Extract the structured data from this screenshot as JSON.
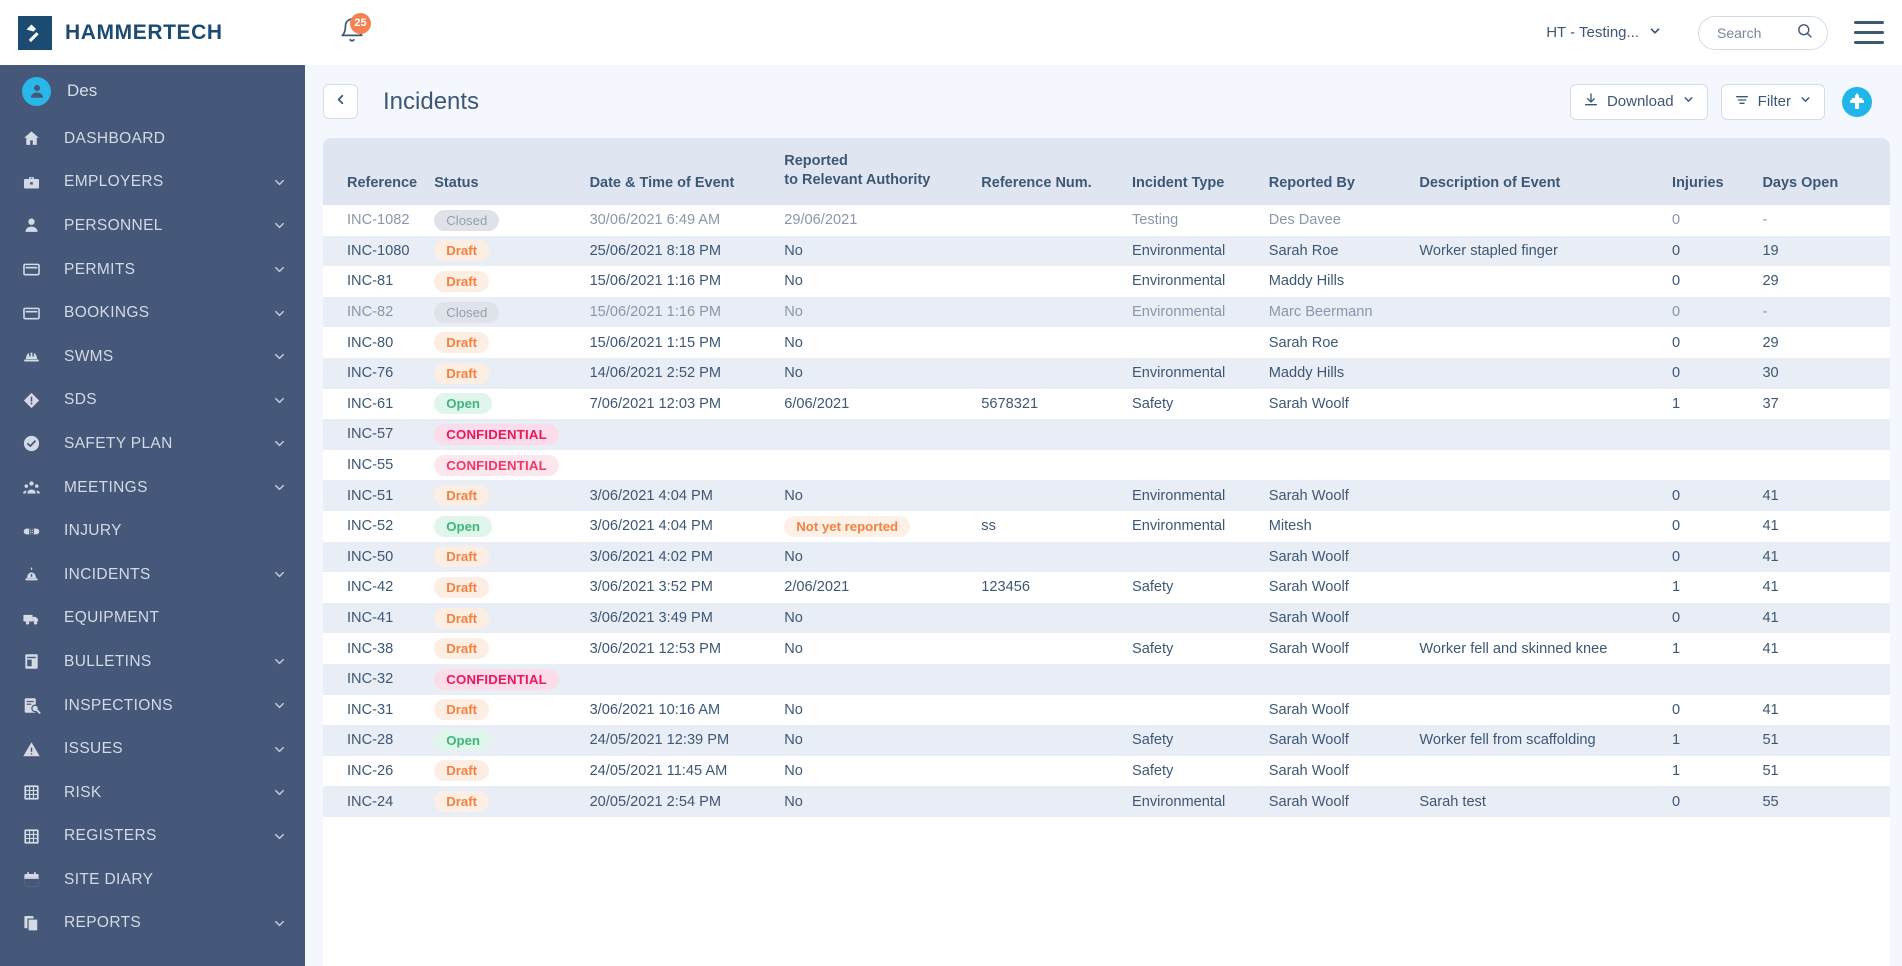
{
  "topbar": {
    "brand": "HAMMERTECH",
    "brand_icon": "hammer-logo-icon",
    "notification_icon": "bell-icon",
    "notification_count": "25",
    "site_selector_label": "HT - Testing...",
    "site_selector_caret": "chevron-down-icon",
    "search_placeholder": "Search",
    "search_value": "",
    "search_icon": "search-icon",
    "menu_icon": "hamburger-menu-icon"
  },
  "sidebar": {
    "user": {
      "name": "Des",
      "avatar_icon": "user-avatar-icon"
    },
    "items": [
      {
        "label": "DASHBOARD",
        "icon": "home-icon",
        "expandable": false
      },
      {
        "label": "EMPLOYERS",
        "icon": "briefcase-icon",
        "expandable": true
      },
      {
        "label": "PERSONNEL",
        "icon": "person-icon",
        "expandable": true
      },
      {
        "label": "PERMITS",
        "icon": "card-icon",
        "expandable": true
      },
      {
        "label": "BOOKINGS",
        "icon": "card-icon",
        "expandable": true
      },
      {
        "label": "SWMS",
        "icon": "hardhat-icon",
        "expandable": true
      },
      {
        "label": "SDS",
        "icon": "diamond-alert-icon",
        "expandable": true
      },
      {
        "label": "SAFETY PLAN",
        "icon": "check-circle-icon",
        "expandable": true
      },
      {
        "label": "MEETINGS",
        "icon": "people-group-icon",
        "expandable": true
      },
      {
        "label": "INJURY",
        "icon": "bandage-icon",
        "expandable": false
      },
      {
        "label": "INCIDENTS",
        "icon": "siren-icon",
        "expandable": true
      },
      {
        "label": "EQUIPMENT",
        "icon": "truck-icon",
        "expandable": false
      },
      {
        "label": "BULLETINS",
        "icon": "bulletin-icon",
        "expandable": true
      },
      {
        "label": "INSPECTIONS",
        "icon": "inspection-icon",
        "expandable": true
      },
      {
        "label": "ISSUES",
        "icon": "warning-triangle-icon",
        "expandable": true
      },
      {
        "label": "RISK",
        "icon": "grid-matrix-icon",
        "expandable": true
      },
      {
        "label": "REGISTERS",
        "icon": "grid-matrix-icon",
        "expandable": true
      },
      {
        "label": "SITE DIARY",
        "icon": "calendar-icon",
        "expandable": false
      },
      {
        "label": "REPORTS",
        "icon": "documents-icon",
        "expandable": true
      }
    ]
  },
  "page": {
    "back_icon": "chevron-left-icon",
    "title": "Incidents",
    "download_label": "Download",
    "download_icon": "download-icon",
    "download_caret": "chevron-down-icon",
    "filter_label": "Filter",
    "filter_icon": "filter-icon",
    "filter_caret": "chevron-down-icon",
    "add_icon": "plus-icon"
  },
  "table": {
    "columns": [
      {
        "key": "reference",
        "label": "Reference"
      },
      {
        "key": "status",
        "label": "Status"
      },
      {
        "key": "datetime",
        "label": "Date & Time of Event"
      },
      {
        "key": "reported",
        "label_line1": "Reported",
        "label_line2": "to Relevant Authority"
      },
      {
        "key": "refnum",
        "label": "Reference Num."
      },
      {
        "key": "type",
        "label": "Incident Type"
      },
      {
        "key": "reportedby",
        "label": "Reported By"
      },
      {
        "key": "description",
        "label": "Description of Event"
      },
      {
        "key": "injuries",
        "label": "Injuries"
      },
      {
        "key": "daysopen",
        "label": "Days Open"
      }
    ],
    "rows": [
      {
        "reference": "INC-1082",
        "status": "Closed",
        "status_kind": "closed",
        "muted": true,
        "datetime": "30/06/2021 6:49 AM",
        "reported": "29/06/2021",
        "reported_kind": "text",
        "refnum": "",
        "type": "Testing",
        "reportedby": "Des Davee",
        "description": "",
        "injuries": "0",
        "daysopen": "-"
      },
      {
        "reference": "INC-1080",
        "status": "Draft",
        "status_kind": "draft",
        "muted": false,
        "datetime": "25/06/2021 8:18 PM",
        "reported": "No",
        "reported_kind": "text",
        "refnum": "",
        "type": "Environmental",
        "reportedby": "Sarah Roe",
        "description": "Worker stapled finger",
        "injuries": "0",
        "daysopen": "19"
      },
      {
        "reference": "INC-81",
        "status": "Draft",
        "status_kind": "draft",
        "muted": false,
        "datetime": "15/06/2021 1:16 PM",
        "reported": "No",
        "reported_kind": "text",
        "refnum": "",
        "type": "Environmental",
        "reportedby": "Maddy Hills",
        "description": "",
        "injuries": "0",
        "daysopen": "29"
      },
      {
        "reference": "INC-82",
        "status": "Closed",
        "status_kind": "closed",
        "muted": true,
        "datetime": "15/06/2021 1:16 PM",
        "reported": "No",
        "reported_kind": "text",
        "refnum": "",
        "type": "Environmental",
        "reportedby": "Marc Beermann",
        "description": "",
        "injuries": "0",
        "daysopen": "-"
      },
      {
        "reference": "INC-80",
        "status": "Draft",
        "status_kind": "draft",
        "muted": false,
        "datetime": "15/06/2021 1:15 PM",
        "reported": "No",
        "reported_kind": "text",
        "refnum": "",
        "type": "",
        "reportedby": "Sarah Roe",
        "description": "",
        "injuries": "0",
        "daysopen": "29"
      },
      {
        "reference": "INC-76",
        "status": "Draft",
        "status_kind": "draft",
        "muted": false,
        "datetime": "14/06/2021 2:52 PM",
        "reported": "No",
        "reported_kind": "text",
        "refnum": "",
        "type": "Environmental",
        "reportedby": "Maddy Hills",
        "description": "",
        "injuries": "0",
        "daysopen": "30"
      },
      {
        "reference": "INC-61",
        "status": "Open",
        "status_kind": "open",
        "muted": false,
        "datetime": "7/06/2021 12:03 PM",
        "reported": "6/06/2021",
        "reported_kind": "text",
        "refnum": "5678321",
        "type": "Safety",
        "reportedby": "Sarah Woolf",
        "description": "",
        "injuries": "1",
        "daysopen": "37"
      },
      {
        "reference": "INC-57",
        "status": "CONFIDENTIAL",
        "status_kind": "confidential",
        "muted": false,
        "datetime": "",
        "reported": "",
        "reported_kind": "text",
        "refnum": "",
        "type": "",
        "reportedby": "",
        "description": "",
        "injuries": "",
        "daysopen": ""
      },
      {
        "reference": "INC-55",
        "status": "CONFIDENTIAL",
        "status_kind": "confidential-light",
        "muted": false,
        "datetime": "",
        "reported": "",
        "reported_kind": "text",
        "refnum": "",
        "type": "",
        "reportedby": "",
        "description": "",
        "injuries": "",
        "daysopen": ""
      },
      {
        "reference": "INC-51",
        "status": "Draft",
        "status_kind": "draft",
        "muted": false,
        "datetime": "3/06/2021 4:04 PM",
        "reported": "No",
        "reported_kind": "text",
        "refnum": "",
        "type": "Environmental",
        "reportedby": "Sarah Woolf",
        "description": "",
        "injuries": "0",
        "daysopen": "41"
      },
      {
        "reference": "INC-52",
        "status": "Open",
        "status_kind": "open",
        "muted": false,
        "datetime": "3/06/2021 4:04 PM",
        "reported": "Not yet reported",
        "reported_kind": "pill",
        "refnum": "ss",
        "type": "Environmental",
        "reportedby": "Mitesh",
        "description": "",
        "injuries": "0",
        "daysopen": "41"
      },
      {
        "reference": "INC-50",
        "status": "Draft",
        "status_kind": "draft",
        "muted": false,
        "datetime": "3/06/2021 4:02 PM",
        "reported": "No",
        "reported_kind": "text",
        "refnum": "",
        "type": "",
        "reportedby": "Sarah Woolf",
        "description": "",
        "injuries": "0",
        "daysopen": "41"
      },
      {
        "reference": "INC-42",
        "status": "Draft",
        "status_kind": "draft",
        "muted": false,
        "datetime": "3/06/2021 3:52 PM",
        "reported": "2/06/2021",
        "reported_kind": "text",
        "refnum": "123456",
        "type": "Safety",
        "reportedby": "Sarah Woolf",
        "description": "",
        "injuries": "1",
        "daysopen": "41"
      },
      {
        "reference": "INC-41",
        "status": "Draft",
        "status_kind": "draft",
        "muted": false,
        "datetime": "3/06/2021 3:49 PM",
        "reported": "No",
        "reported_kind": "text",
        "refnum": "",
        "type": "",
        "reportedby": "Sarah Woolf",
        "description": "",
        "injuries": "0",
        "daysopen": "41"
      },
      {
        "reference": "INC-38",
        "status": "Draft",
        "status_kind": "draft",
        "muted": false,
        "datetime": "3/06/2021 12:53 PM",
        "reported": "No",
        "reported_kind": "text",
        "refnum": "",
        "type": "Safety",
        "reportedby": "Sarah Woolf",
        "description": "Worker fell and skinned knee",
        "injuries": "1",
        "daysopen": "41"
      },
      {
        "reference": "INC-32",
        "status": "CONFIDENTIAL",
        "status_kind": "confidential",
        "muted": false,
        "datetime": "",
        "reported": "",
        "reported_kind": "text",
        "refnum": "",
        "type": "",
        "reportedby": "",
        "description": "",
        "injuries": "",
        "daysopen": ""
      },
      {
        "reference": "INC-31",
        "status": "Draft",
        "status_kind": "draft",
        "muted": false,
        "datetime": "3/06/2021 10:16 AM",
        "reported": "No",
        "reported_kind": "text",
        "refnum": "",
        "type": "",
        "reportedby": "Sarah Woolf",
        "description": "",
        "injuries": "0",
        "daysopen": "41"
      },
      {
        "reference": "INC-28",
        "status": "Open",
        "status_kind": "open",
        "muted": false,
        "datetime": "24/05/2021 12:39 PM",
        "reported": "No",
        "reported_kind": "text",
        "refnum": "",
        "type": "Safety",
        "reportedby": "Sarah Woolf",
        "description": "Worker fell from scaffolding",
        "injuries": "1",
        "daysopen": "51"
      },
      {
        "reference": "INC-26",
        "status": "Draft",
        "status_kind": "draft",
        "muted": false,
        "datetime": "24/05/2021 11:45 AM",
        "reported": "No",
        "reported_kind": "text",
        "refnum": "",
        "type": "Safety",
        "reportedby": "Sarah Woolf",
        "description": "",
        "injuries": "1",
        "daysopen": "51"
      },
      {
        "reference": "INC-24",
        "status": "Draft",
        "status_kind": "draft",
        "muted": false,
        "datetime": "20/05/2021 2:54 PM",
        "reported": "No",
        "reported_kind": "text",
        "refnum": "",
        "type": "Environmental",
        "reportedby": "Sarah Woolf",
        "description": "Sarah test",
        "injuries": "0",
        "daysopen": "55"
      }
    ]
  },
  "colors": {
    "brand_navy": "#1b4a72",
    "sidebar_bg": "#45587a",
    "accent_cyan": "#21b6ea",
    "accent_orange": "#f58153",
    "status_draft": "#f57f3f",
    "status_open": "#3cb878",
    "status_confidential": "#ec1560",
    "page_bg": "#f4f7fd",
    "table_header_bg": "#dfe6f2"
  }
}
